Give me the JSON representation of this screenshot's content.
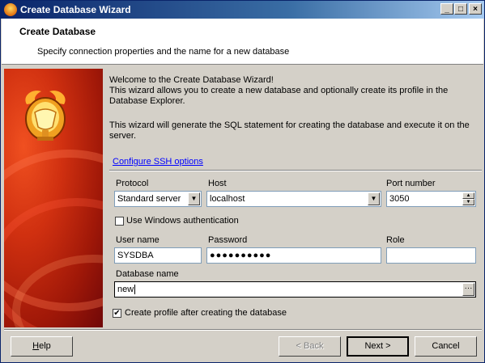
{
  "window": {
    "title": "Create Database Wizard",
    "controls": {
      "minimize": "_",
      "maximize": "□",
      "close": "×"
    }
  },
  "header": {
    "title": "Create Database",
    "subtitle": "Specify connection properties and the name for a new database"
  },
  "intro": {
    "line1": "Welcome to the Create Database Wizard!",
    "line2": "This wizard allows you to create a new database and optionally create its profile in the",
    "line3": "Database Explorer.",
    "line4": "This wizard will generate the SQL statement for creating the database and execute it on the",
    "line5": "server."
  },
  "ssh_link": "Configure SSH options",
  "protocol": {
    "label": "Protocol",
    "value": "Standard server"
  },
  "host": {
    "label": "Host",
    "value": "localhost"
  },
  "port": {
    "label": "Port number",
    "value": "3050"
  },
  "windows_auth": {
    "label": "Use Windows authentication",
    "checked": false
  },
  "user": {
    "label": "User name",
    "value": "SYSDBA"
  },
  "password": {
    "label": "Password",
    "value": "●●●●●●●●●●"
  },
  "role": {
    "label": "Role",
    "value": ""
  },
  "dbname": {
    "label": "Database name",
    "value": "new",
    "browse": "···"
  },
  "create_profile": {
    "label": "Create profile after creating the database",
    "checked": true,
    "mark": "✔"
  },
  "buttons": {
    "help": "Help",
    "back": "< Back",
    "next": "Next >",
    "cancel": "Cancel"
  },
  "colors": {
    "accent": "#0a246a",
    "sidebar": "#d03010"
  }
}
